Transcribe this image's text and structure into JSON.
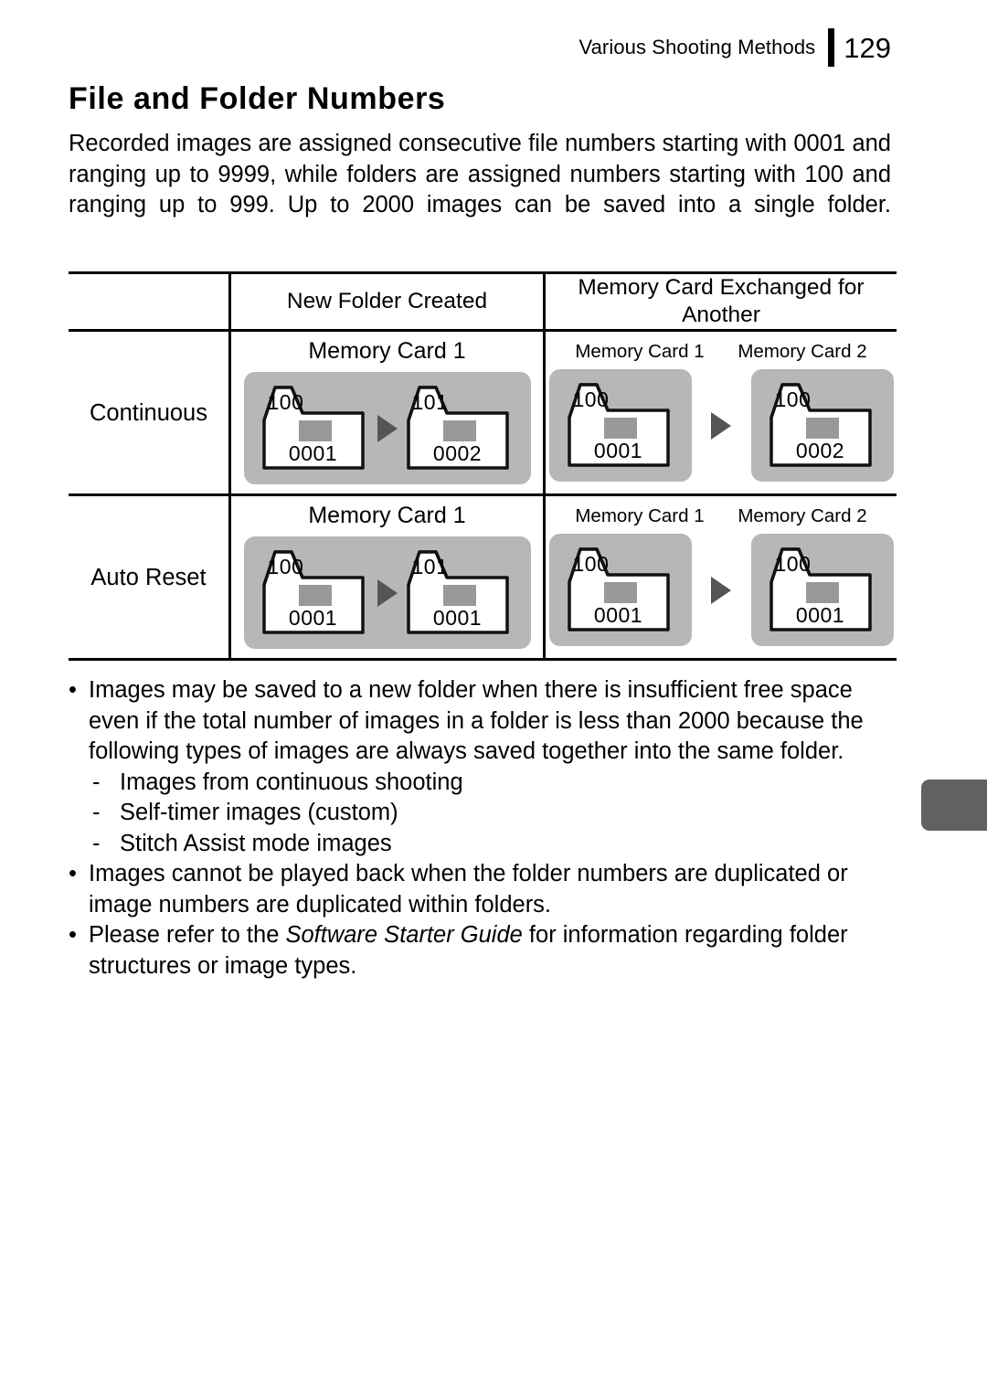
{
  "header": {
    "title": "Various Shooting Methods",
    "page_number": "129"
  },
  "doc": {
    "title": "File and Folder Numbers",
    "intro": "Recorded images are assigned consecutive file numbers starting with 0001 and ranging up to 9999, while folders are assigned numbers starting with 100 and ranging up to 999. Up to 2000 images can be saved into a single folder."
  },
  "table": {
    "col_headers": {
      "blank": "",
      "new_folder": "New Folder Created",
      "exchanged": "Memory Card Exchanged for Another"
    },
    "rows": [
      {
        "label": "Continuous",
        "new_folder": {
          "sub_head": "Memory Card 1",
          "folders": [
            {
              "folder": "100",
              "file": "0001"
            },
            {
              "folder": "101",
              "file": "0002"
            }
          ]
        },
        "exchanged": {
          "sub_head_left": "Memory Card 1",
          "sub_head_right": "Memory Card 2",
          "folder_left": {
            "folder": "100",
            "file": "0001"
          },
          "folder_right": {
            "folder": "100",
            "file": "0002"
          }
        }
      },
      {
        "label": "Auto Reset",
        "new_folder": {
          "sub_head": "Memory Card 1",
          "folders": [
            {
              "folder": "100",
              "file": "0001"
            },
            {
              "folder": "101",
              "file": "0001"
            }
          ]
        },
        "exchanged": {
          "sub_head_left": "Memory Card 1",
          "sub_head_right": "Memory Card 2",
          "folder_left": {
            "folder": "100",
            "file": "0001"
          },
          "folder_right": {
            "folder": "100",
            "file": "0001"
          }
        }
      }
    ]
  },
  "notes": {
    "bullet_marker": "•",
    "dash_marker": "-",
    "items": [
      {
        "text": "Images may be saved to a new folder when there is insufficient free space even if the total number of images in a folder is less than 2000 because the following types of images are always saved together into the same folder.",
        "sub_items": [
          "Images from continuous shooting",
          "Self-timer images (custom)",
          "Stitch Assist mode images"
        ]
      },
      {
        "text": "Images cannot be played back when the folder numbers are duplicated or image numbers are duplicated within folders.",
        "sub_items": []
      }
    ],
    "last_item": {
      "pre": "Please refer to the ",
      "italic": "Software Starter Guide",
      "post": " for information regarding folder structures or image types."
    }
  },
  "colors": {
    "panel_gray": "#b7b7b7",
    "chip_gray": "#999999",
    "arrow_gray": "#555555",
    "edge_tab_gray": "#616161",
    "rule_black": "#000000"
  }
}
